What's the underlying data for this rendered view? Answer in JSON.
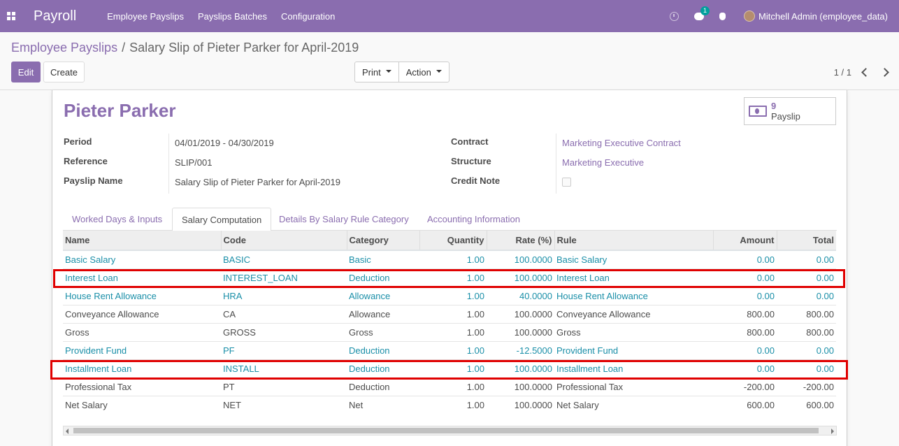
{
  "navbar": {
    "brand": "Payroll",
    "menu": [
      "Employee Payslips",
      "Payslips Batches",
      "Configuration"
    ],
    "chat_badge": "1",
    "user": "Mitchell Admin (employee_data)"
  },
  "breadcrumb": {
    "parent": "Employee Payslips",
    "separator": "/",
    "current": "Salary Slip of Pieter Parker for April-2019"
  },
  "buttons": {
    "edit": "Edit",
    "create": "Create",
    "print": "Print",
    "action": "Action"
  },
  "pager": {
    "value": "1 / 1"
  },
  "form": {
    "title": "Pieter Parker",
    "smart_button": {
      "count": "9",
      "label": "Payslip"
    },
    "left_fields": [
      {
        "label": "Period",
        "value": "04/01/2019 - 04/30/2019"
      },
      {
        "label": "Reference",
        "value": "SLIP/001"
      },
      {
        "label": "Payslip Name",
        "value": "Salary Slip of Pieter Parker for April-2019"
      }
    ],
    "right_fields": [
      {
        "label": "Contract",
        "value": "Marketing Executive Contract"
      },
      {
        "label": "Structure",
        "value": "Marketing Executive"
      },
      {
        "label": "Credit Note",
        "value": ""
      }
    ]
  },
  "tabs": [
    "Worked Days & Inputs",
    "Salary Computation",
    "Details By Salary Rule Category",
    "Accounting Information"
  ],
  "table": {
    "headers": [
      "Name",
      "Code",
      "Category",
      "Quantity",
      "Rate (%)",
      "Rule",
      "Amount",
      "Total"
    ],
    "rows": [
      [
        "Basic Salary",
        "BASIC",
        "Basic",
        "1.00",
        "100.0000",
        "Basic Salary",
        "0.00",
        "0.00"
      ],
      [
        "Interest Loan",
        "INTEREST_LOAN",
        "Deduction",
        "1.00",
        "100.0000",
        "Interest Loan",
        "0.00",
        "0.00"
      ],
      [
        "House Rent Allowance",
        "HRA",
        "Allowance",
        "1.00",
        "40.0000",
        "House Rent Allowance",
        "0.00",
        "0.00"
      ],
      [
        "Conveyance Allowance",
        "CA",
        "Allowance",
        "1.00",
        "100.0000",
        "Conveyance Allowance",
        "800.00",
        "800.00"
      ],
      [
        "Gross",
        "GROSS",
        "Gross",
        "1.00",
        "100.0000",
        "Gross",
        "800.00",
        "800.00"
      ],
      [
        "Provident Fund",
        "PF",
        "Deduction",
        "1.00",
        "-12.5000",
        "Provident Fund",
        "0.00",
        "0.00"
      ],
      [
        "Installment Loan",
        "INSTALL",
        "Deduction",
        "1.00",
        "100.0000",
        "Installment Loan",
        "0.00",
        "0.00"
      ],
      [
        "Professional Tax",
        "PT",
        "Deduction",
        "1.00",
        "100.0000",
        "Professional Tax",
        "-200.00",
        "-200.00"
      ],
      [
        "Net Salary",
        "NET",
        "Net",
        "1.00",
        "100.0000",
        "Net Salary",
        "600.00",
        "600.00"
      ]
    ]
  },
  "colors": {
    "brand": "#8a6daf",
    "link_teal": "#1a8fa8",
    "highlight": "#e00000"
  }
}
